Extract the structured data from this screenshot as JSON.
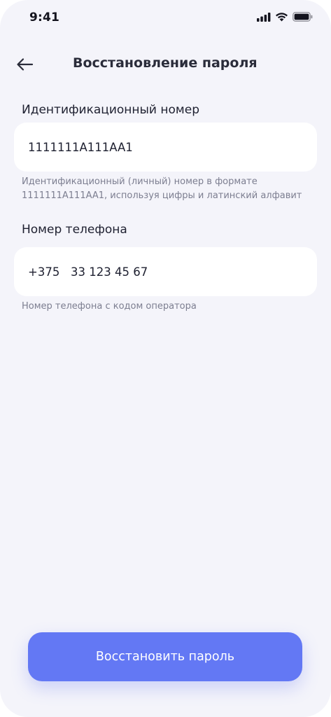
{
  "status_bar": {
    "time": "9:41",
    "icons": [
      "signal-icon",
      "wifi-icon",
      "battery-icon"
    ]
  },
  "header": {
    "title": "Восстановление пароля",
    "back_icon": "arrow-left-icon"
  },
  "form": {
    "id_number": {
      "label": "Идентификационный номер",
      "value": "1111111A111AA1",
      "hint": "Идентификационный (личный) номер в формате\n1111111A111AA1, используя цифры и латинский алфавит"
    },
    "phone": {
      "label": "Номер телефона",
      "value": "+375   33 123 45 67",
      "hint": "Номер телефона с кодом оператора"
    }
  },
  "actions": {
    "submit_label": "Восстановить пароль"
  },
  "colors": {
    "background": "#f4f4fa",
    "field_background": "#ffffff",
    "accent": "#6378f4",
    "title_text": "#2a2c3a",
    "hint_text": "#7c7e90"
  }
}
